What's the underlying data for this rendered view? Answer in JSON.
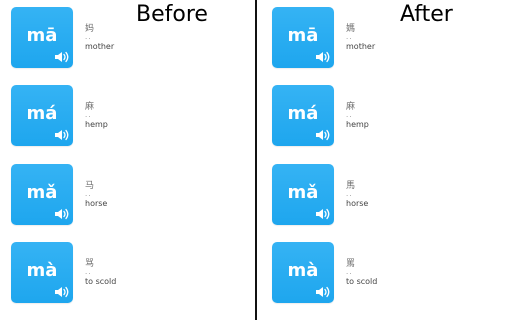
{
  "colors": {
    "card": "#1ea6ee",
    "divider": "#111111"
  },
  "panels": [
    {
      "title": "Before",
      "items": [
        {
          "pinyin": "mā",
          "hanzi": "妈",
          "dots": "..",
          "gloss": "mother",
          "icon": "speaker-icon"
        },
        {
          "pinyin": "má",
          "hanzi": "麻",
          "dots": "..",
          "gloss": "hemp",
          "icon": "speaker-icon"
        },
        {
          "pinyin": "mǎ",
          "hanzi": "马",
          "dots": "..",
          "gloss": "horse",
          "icon": "speaker-icon"
        },
        {
          "pinyin": "mà",
          "hanzi": "骂",
          "dots": "..",
          "gloss": "to scold",
          "icon": "speaker-icon"
        }
      ]
    },
    {
      "title": "After",
      "items": [
        {
          "pinyin": "mā",
          "hanzi": "媽",
          "dots": "..",
          "gloss": "mother",
          "icon": "speaker-icon"
        },
        {
          "pinyin": "má",
          "hanzi": "麻",
          "dots": "..",
          "gloss": "hemp",
          "icon": "speaker-icon"
        },
        {
          "pinyin": "mǎ",
          "hanzi": "馬",
          "dots": "..",
          "gloss": "horse",
          "icon": "speaker-icon"
        },
        {
          "pinyin": "mà",
          "hanzi": "罵",
          "dots": "..",
          "gloss": "to scold",
          "icon": "speaker-icon"
        }
      ]
    }
  ]
}
